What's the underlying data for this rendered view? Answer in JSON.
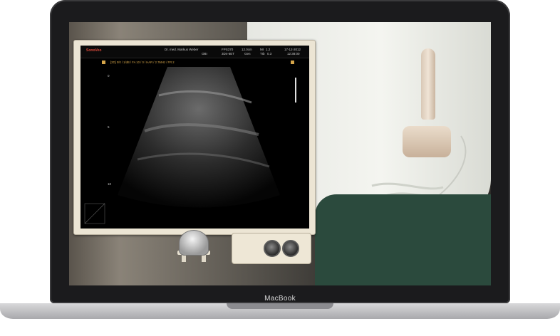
{
  "device": {
    "brand_label": "MacBook"
  },
  "ultrasound": {
    "logo": "SonoVeo",
    "header": {
      "operator": "Dr. med. Markus Weber",
      "clinic": "OBI",
      "fps": "FPS370",
      "probe": "3D4-6ET",
      "depth": "12.0cm",
      "gen": "Gen",
      "mi_label": "MI",
      "mi_value": "1.2",
      "tib_label": "TIb",
      "tib_value": "0.3",
      "date": "17-12-2012",
      "time": "12:38:00"
    },
    "status_line": "[2D] 0/0 / 1/dB / FA 10 / 0 / HAR / 2.7MHz / FR 2",
    "depth_marks": [
      "0",
      "5",
      "10"
    ]
  },
  "icons": {
    "knob_left": "knob-icon",
    "knob_right": "knob-icon",
    "trackball": "trackball-icon"
  },
  "colors": {
    "monitor_bezel": "#ece5d4",
    "ultrasound_bg": "#000000",
    "status_text": "#d6a64a",
    "pants": "#2b4a3d",
    "laptop_lid": "#1b1b1d"
  }
}
